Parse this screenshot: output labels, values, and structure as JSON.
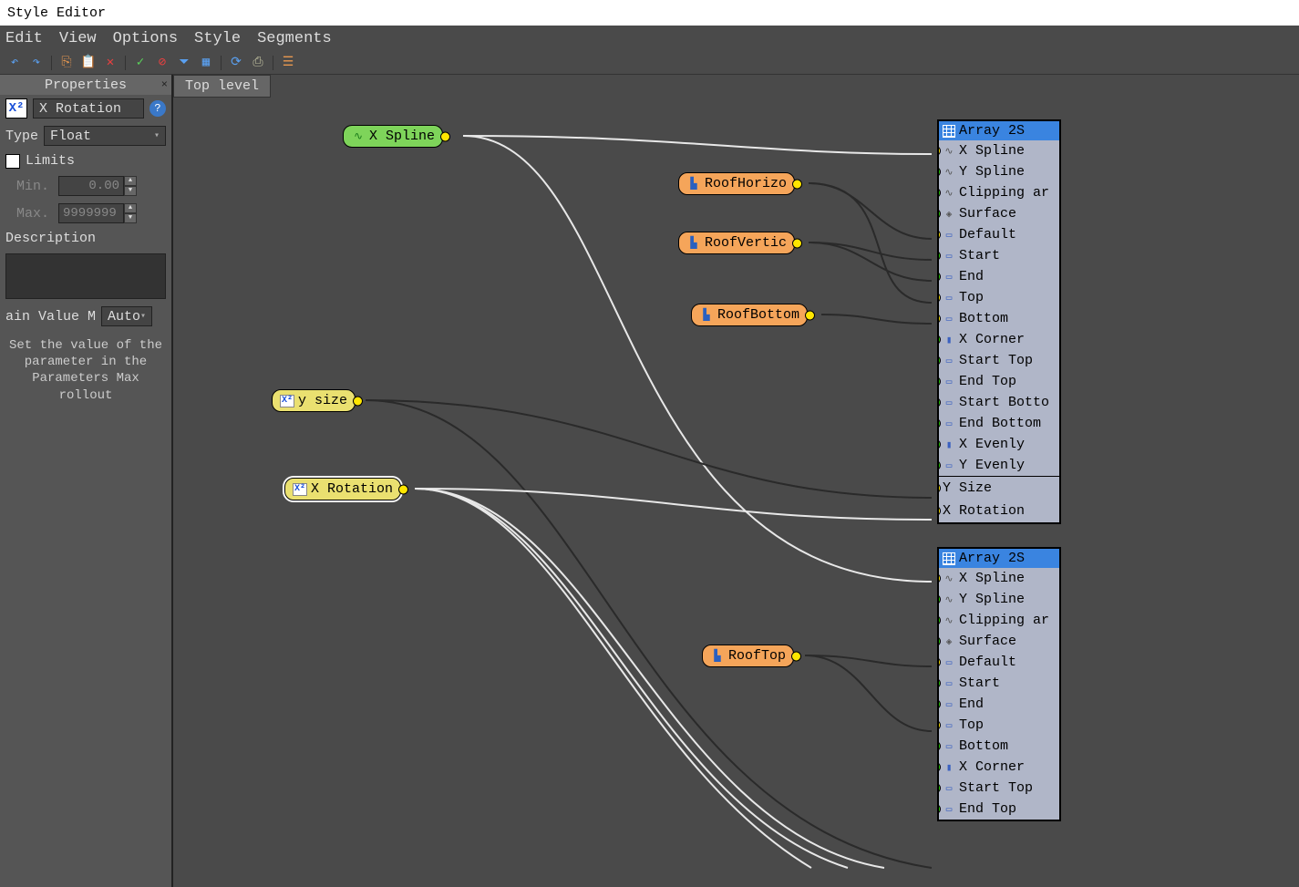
{
  "title": "Style Editor",
  "menu": {
    "edit": "Edit",
    "view": "View",
    "options": "Options",
    "style": "Style",
    "segments": "Segments"
  },
  "properties": {
    "panel_title": "Properties",
    "param_icon": "X²",
    "param_name": "X Rotation",
    "type_label": "Type",
    "type_value": "Float",
    "limits_label": "Limits",
    "min_label": "Min.",
    "min_value": "0.00",
    "max_label": "Max.",
    "max_value": "9999999.0",
    "description_label": "Description",
    "val_label": "ain Value M",
    "val_select": "Auto",
    "help_text": "Set the value of the parameter in the Parameters Max rollout"
  },
  "tabs": {
    "top_level": "Top level"
  },
  "nodes": {
    "xspline": "X Spline",
    "ysize": "y size",
    "xrotation": "X Rotation",
    "roofhoriz": "RoofHorizo",
    "roofvert": "RoofVertic",
    "roofbottom": "RoofBottom",
    "rooftop": "RoofTop"
  },
  "array": {
    "title": "Array 2S",
    "rows": [
      {
        "label": "X Spline",
        "port": "yellow",
        "icon": "spline"
      },
      {
        "label": "Y Spline",
        "port": "green",
        "icon": "spline"
      },
      {
        "label": "Clipping ar",
        "port": "green",
        "icon": "spline"
      },
      {
        "label": "Surface",
        "port": "green",
        "icon": "surface"
      },
      {
        "label": "Default",
        "port": "yellow",
        "icon": "seg"
      },
      {
        "label": "Start",
        "port": "green",
        "icon": "seg"
      },
      {
        "label": "End",
        "port": "green",
        "icon": "seg"
      },
      {
        "label": "Top",
        "port": "yellow",
        "icon": "seg"
      },
      {
        "label": "Bottom",
        "port": "yellow",
        "icon": "seg"
      },
      {
        "label": "X Corner",
        "port": "green",
        "icon": "corner"
      },
      {
        "label": "Start Top",
        "port": "green",
        "icon": "seg"
      },
      {
        "label": "End Top",
        "port": "green",
        "icon": "seg"
      },
      {
        "label": "Start Botto",
        "port": "green",
        "icon": "seg"
      },
      {
        "label": "End Bottom",
        "port": "green",
        "icon": "seg"
      },
      {
        "label": "X Evenly",
        "port": "green",
        "icon": "corner"
      },
      {
        "label": "Y Evenly",
        "port": "green",
        "icon": "seg"
      }
    ],
    "footer": [
      {
        "label": "Y Size",
        "port": "yellow"
      },
      {
        "label": "X Rotation",
        "port": "yellow"
      }
    ]
  },
  "array2": {
    "title": "Array 2S",
    "rows": [
      {
        "label": "X Spline",
        "port": "yellow",
        "icon": "spline"
      },
      {
        "label": "Y Spline",
        "port": "green",
        "icon": "spline"
      },
      {
        "label": "Clipping ar",
        "port": "green",
        "icon": "spline"
      },
      {
        "label": "Surface",
        "port": "green",
        "icon": "surface"
      },
      {
        "label": "Default",
        "port": "yellow",
        "icon": "seg"
      },
      {
        "label": "Start",
        "port": "green",
        "icon": "seg"
      },
      {
        "label": "End",
        "port": "green",
        "icon": "seg"
      },
      {
        "label": "Top",
        "port": "yellow",
        "icon": "seg"
      },
      {
        "label": "Bottom",
        "port": "green",
        "icon": "seg"
      },
      {
        "label": "X Corner",
        "port": "green",
        "icon": "corner"
      },
      {
        "label": "Start Top",
        "port": "green",
        "icon": "seg"
      },
      {
        "label": "End Top",
        "port": "green",
        "icon": "seg"
      }
    ]
  }
}
